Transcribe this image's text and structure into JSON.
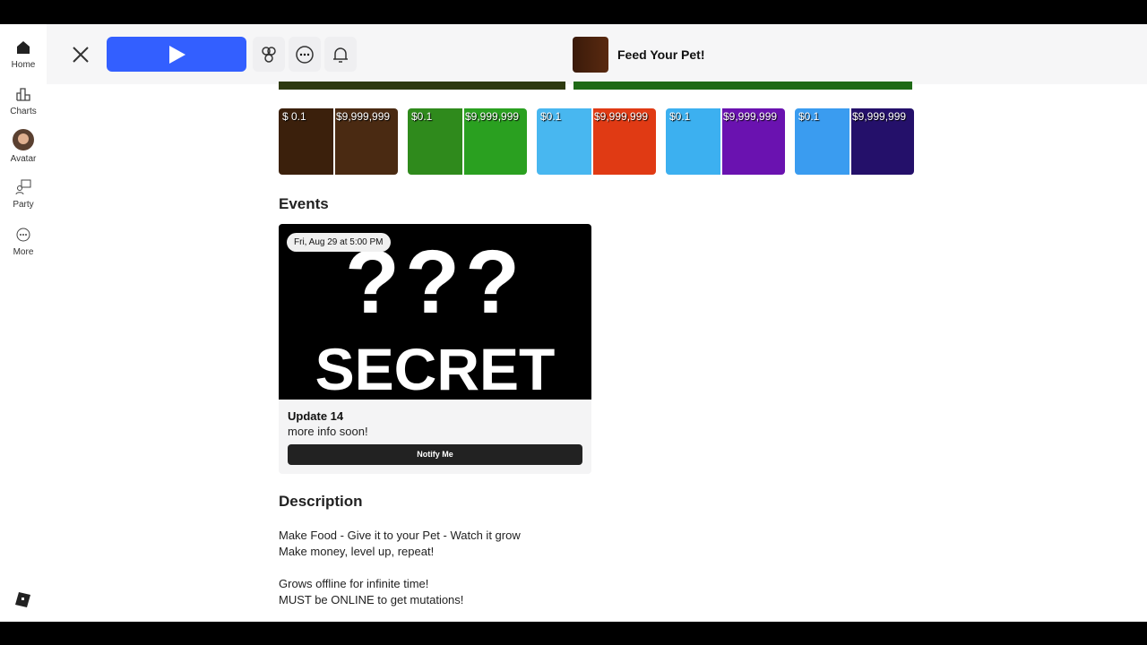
{
  "sidebar": {
    "items": [
      {
        "label": "Home"
      },
      {
        "label": "Charts"
      },
      {
        "label": "Avatar"
      },
      {
        "label": "Party"
      },
      {
        "label": "More"
      }
    ]
  },
  "header": {
    "game_title": "Feed Your Pet!"
  },
  "thumbnails": [
    {
      "low": "$ 0.1",
      "high": "$9,999,999",
      "lc": "#3b200c",
      "rc": "#4a2a12"
    },
    {
      "low": "$0.1",
      "high": "$9,999,999",
      "lc": "#2f8a1c",
      "rc": "#2aa020"
    },
    {
      "low": "$0.1",
      "high": "$9,999,999",
      "lc": "#48b7f0",
      "rc": "#e03a14"
    },
    {
      "low": "$0.1",
      "high": "$9,999,999",
      "lc": "#3cb0f0",
      "rc": "#6a12b0"
    },
    {
      "low": "$0.1",
      "high": "$9,999,999",
      "lc": "#3a9cf0",
      "rc": "#24106a"
    }
  ],
  "events": {
    "heading": "Events",
    "date": "Fri, Aug 29 at 5:00 PM",
    "image_text_top": "???",
    "image_text_bottom": "SECRET",
    "title": "Update 14",
    "subtitle": "more info soon!",
    "button": "Notify Me"
  },
  "description": {
    "heading": "Description",
    "lines": [
      "Make Food - Give it to your Pet - Watch it grow",
      "Make money, level up, repeat!",
      "Grows offline for infinite time!",
      "MUST be ONLINE to get mutations!"
    ]
  }
}
